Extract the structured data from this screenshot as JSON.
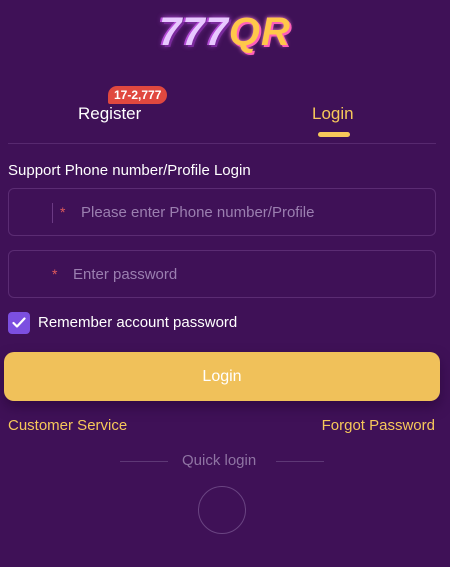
{
  "logo": {
    "numbers": "777",
    "letters": "QR"
  },
  "tabs": {
    "register_label": "Register",
    "register_badge": "17-2,777",
    "login_label": "Login",
    "active": "login"
  },
  "form": {
    "section_title": "Support Phone number/Profile Login",
    "phone_required_mark": "*",
    "phone_placeholder": "Please enter Phone number/Profile",
    "password_required_mark": "*",
    "password_placeholder": "Enter password",
    "remember_label": "Remember account password",
    "remember_checked": true,
    "submit_label": "Login"
  },
  "links": {
    "customer_service": "Customer Service",
    "forgot_password": "Forgot Password"
  },
  "quick_login": {
    "label": "Quick login"
  },
  "colors": {
    "background": "#3f1157",
    "accent": "#f7c85a",
    "button": "#f0c15a",
    "badge": "#e0483f",
    "checkbox": "#7c4fe0"
  }
}
